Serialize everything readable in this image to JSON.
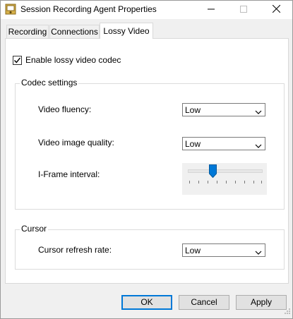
{
  "window": {
    "title": "Session Recording Agent Properties",
    "icon": "app-icon",
    "controls": {
      "minimize": "minimize-icon",
      "maximize": "maximize-icon",
      "close": "close-icon"
    }
  },
  "tabs": [
    {
      "label": "Recording",
      "active": false
    },
    {
      "label": "Connections",
      "active": false
    },
    {
      "label": "Lossy Video",
      "active": true
    }
  ],
  "lossy": {
    "enable_label": "Enable lossy video codec",
    "enable_checked": true
  },
  "codec": {
    "legend": "Codec settings",
    "fluency_label": "Video fluency:",
    "fluency_value": "Low",
    "quality_label": "Video image quality:",
    "quality_value": "Low",
    "iframe_label": "I-Frame interval:",
    "iframe_slider": {
      "position": 3,
      "ticks": 9
    }
  },
  "cursor": {
    "legend": "Cursor",
    "refresh_label": "Cursor refresh rate:",
    "refresh_value": "Low"
  },
  "buttons": {
    "ok": "OK",
    "cancel": "Cancel",
    "apply": "Apply"
  },
  "colors": {
    "accent": "#0078d7",
    "slider_thumb": "#0078d7"
  }
}
